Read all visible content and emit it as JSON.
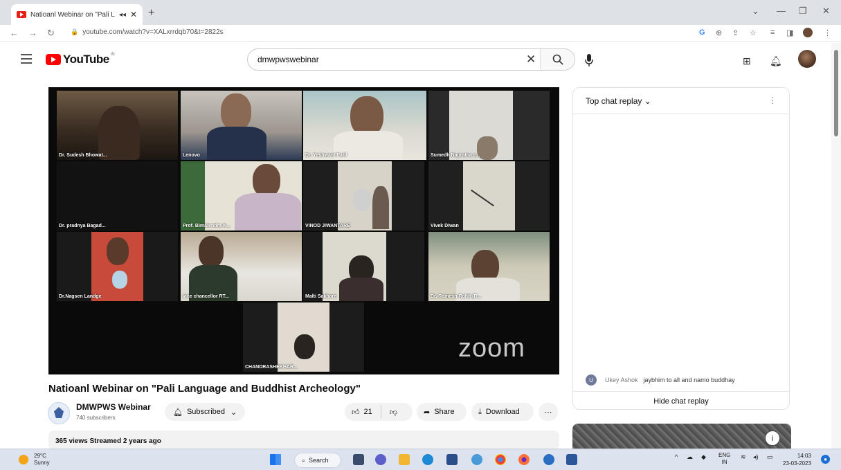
{
  "browser": {
    "tab_title": "Natioanl Webinar on \"Pali La",
    "url": "youtube.com/watch?v=XALxrrdqb70&t=2822s"
  },
  "youtube": {
    "country_code": "IN",
    "search_query": "dmwpwswebinar",
    "logo_text": "YouTube"
  },
  "video": {
    "watermark": "zoom",
    "participants": [
      "Dr. Sudesh Bhowat...",
      "Lenovo",
      "Dr. Yeshwant Patil",
      "Sumedh Nagratna c...",
      "Dr. pradnya Bagad...",
      "Prof. Bimalendra K...",
      "VINOD JIWANTARE",
      "Vivek Diwan",
      "Dr.Nagsen Landge",
      "vice chancellor RT...",
      "Malti Sakhare",
      "Dr. Ramesh Rohit (R...",
      "CHANDRASHEKHAR..."
    ],
    "title": "Natioanl Webinar on \"Pali Language and Buddhist Archeology\"",
    "channel_name": "DMWPWS Webinar",
    "subscribers": "740 subscribers",
    "subscribed_label": "Subscribed",
    "likes": "21",
    "share_label": "Share",
    "download_label": "Download",
    "views_line": "365 views  Streamed 2 years ago"
  },
  "chat": {
    "header": "Top chat replay",
    "message_avatar": "U",
    "message_author": "Ukey Ashok",
    "message_text": "jaybhim to all and namo buddhay",
    "hide_label": "Hide chat replay"
  },
  "taskbar": {
    "temperature": "29°C",
    "weather": "Sunny",
    "search_label": "Search",
    "lang": "ENG",
    "region": "IN",
    "time": "14:03",
    "date": "23-03-2023"
  }
}
